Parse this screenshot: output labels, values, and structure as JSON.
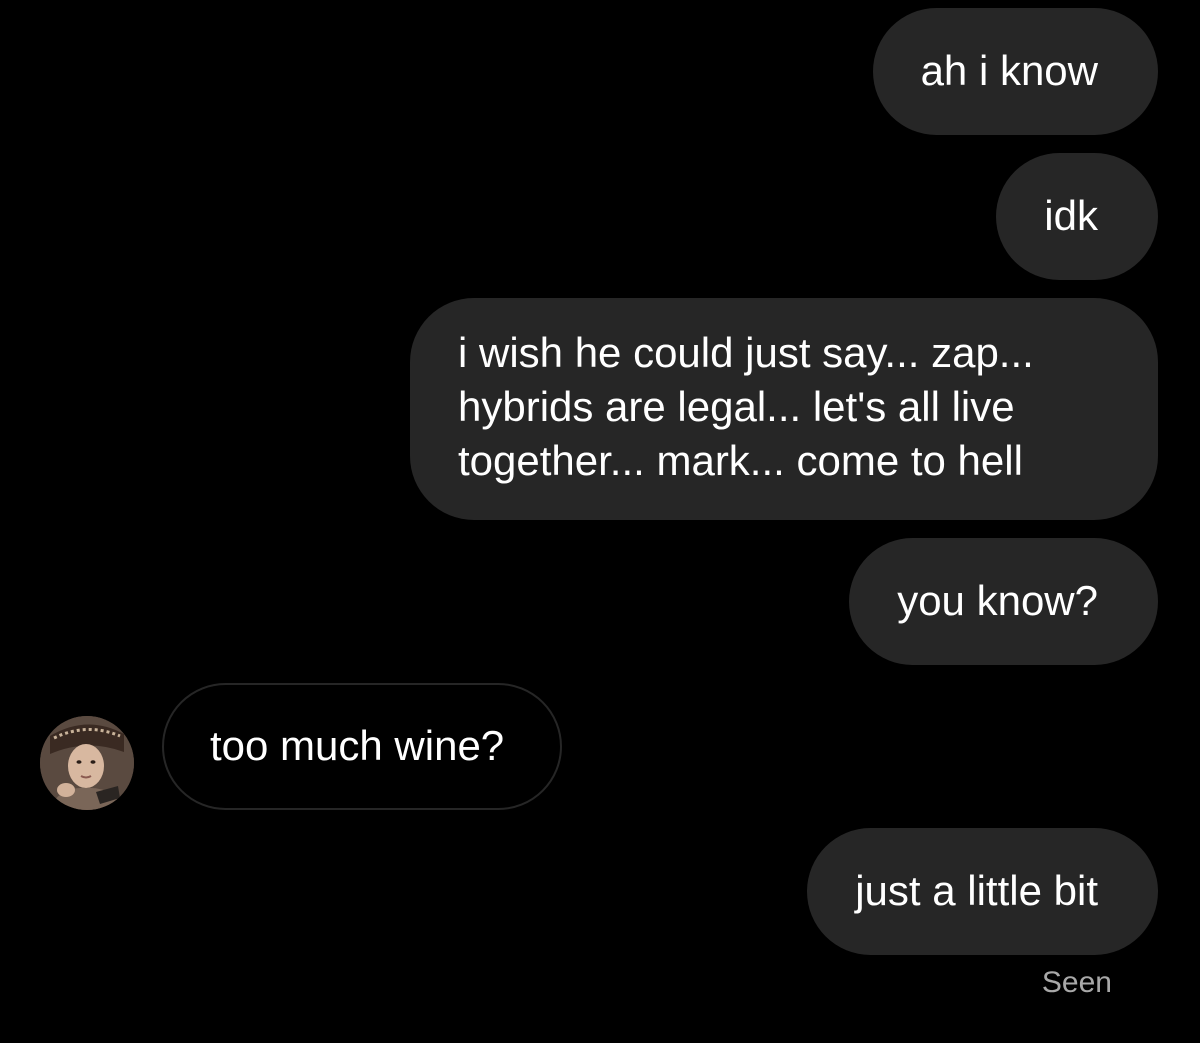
{
  "messages": [
    {
      "direction": "outgoing",
      "text": "ah i know"
    },
    {
      "direction": "outgoing",
      "text": "idk"
    },
    {
      "direction": "outgoing",
      "lines": [
        "i wish he could just say... zap...",
        "hybrids are legal... let's all live",
        "together... mark... come to hell"
      ]
    },
    {
      "direction": "outgoing",
      "text": "you know?"
    },
    {
      "direction": "incoming",
      "text": "too much wine?"
    },
    {
      "direction": "outgoing",
      "text": "just a little bit"
    }
  ],
  "status": {
    "seen_label": "Seen"
  },
  "colors": {
    "background": "#000000",
    "outgoing_bubble": "#262626",
    "incoming_bubble_border": "#262626",
    "text": "#ffffff",
    "status_text": "#a8a8a8"
  },
  "icons": {
    "sender_avatar": "avatar-photo"
  }
}
